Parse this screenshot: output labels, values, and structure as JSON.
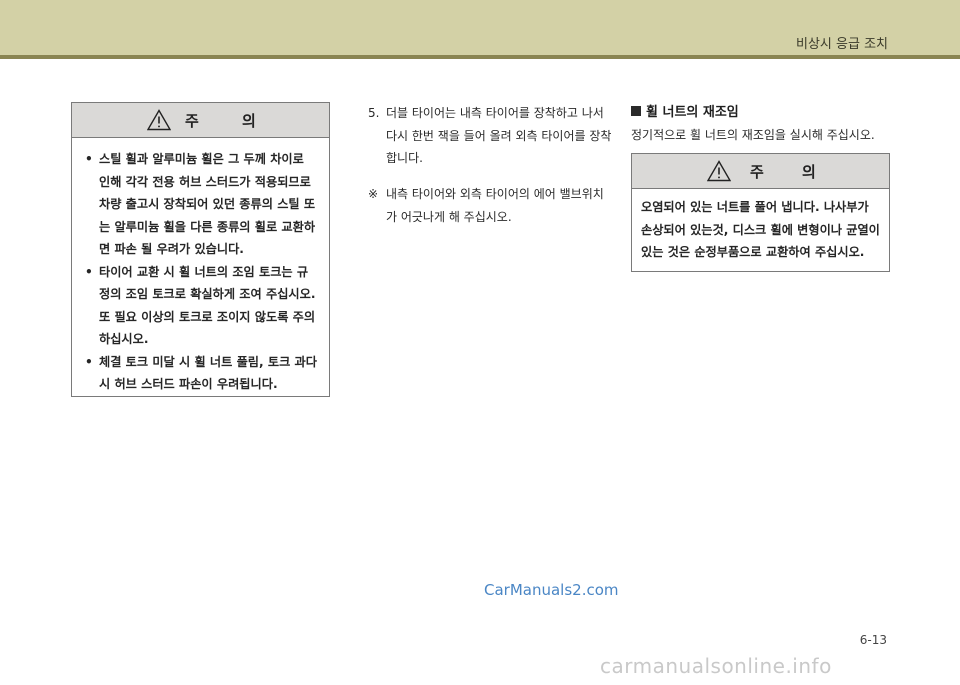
{
  "header": {
    "section_title": "비상시 응급 조치"
  },
  "caution_left": {
    "label_1": "주",
    "label_2": "의",
    "items": [
      "스틸 휠과 알루미늄 휠은 그 두께 차이로 인해 각각 전용 허브 스터드가 적용되므로 차량 출고시 장착되어 있던 종류의 스틸 또는 알루미늄 휠을 다른 종류의 휠로 교환하면 파손 될 우려가 있습니다.",
      "타이어 교환 시 휠 너트의 조임 토크는 규정의 조임 토크로 확실하게 조여 주십시오. 또 필요 이상의 토크로 조이지 않도록 주의하십시오.",
      "체결 토크 미달 시 휠 너트 풀림, 토크 과다시 허브 스터드 파손이 우려됩니다."
    ]
  },
  "step5": {
    "number": "5.",
    "text": "더블 타이어는 내측 타이어를 장착하고 나서 다시 한번 잭을 들어 올려 외측 타이어를 장착합니다."
  },
  "note": {
    "mark": "※",
    "text": "내측 타이어와 외측 타이어의 에어 밸브위치가 어긋나게 해 주십시오."
  },
  "wheel_nut_section": {
    "heading": "휠 너트의 재조임",
    "description": "정기적으로 휠 너트의 재조임을 실시해 주십시오."
  },
  "caution_right": {
    "label_1": "주",
    "label_2": "의",
    "text": "오염되어 있는 너트를 풀어 냅니다. 나사부가 손상되어 있는것, 디스크 휠에 변형이나 균열이 있는 것은 순정부품으로 교환하여 주십시오."
  },
  "watermark": "CarManuals2.com",
  "page_number": "6-13",
  "footer_watermark": "carmanualsonline.info",
  "icons": {
    "warning": "warning-triangle-icon",
    "bullet": "bullet-icon",
    "square": "black-square-icon"
  },
  "colors": {
    "header_band": "#d3d1a6",
    "header_line": "#8a8552",
    "caution_head": "#dad9d7",
    "watermark": "#4a86c5"
  }
}
